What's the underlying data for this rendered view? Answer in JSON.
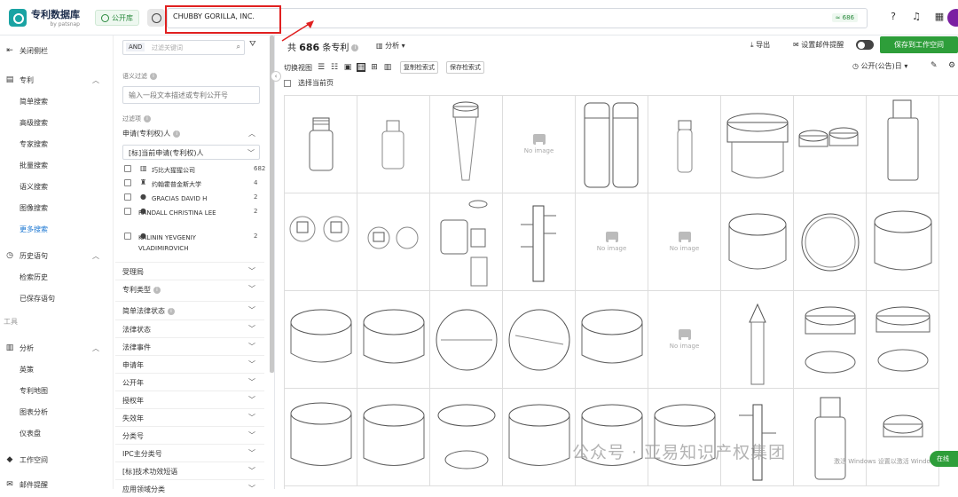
{
  "app": {
    "logo_title": "专利数据库",
    "logo_sub": "by patsnap",
    "db_badge": "公开库"
  },
  "search": {
    "query": "CHUBBY GORILLA, INC.",
    "count_badge": "≈ 686"
  },
  "sidenav": {
    "close": "关闭侧栏",
    "patent_section": "专利",
    "items": [
      "简单搜索",
      "高级搜索",
      "专家搜索",
      "批量搜索",
      "语义搜索",
      "图像搜索",
      "更多搜索"
    ],
    "history_section": "历史语句",
    "history_items": [
      "检索历史",
      "已保存语句"
    ],
    "tools_label": "工具",
    "analysis_section": "分析",
    "analysis_items": [
      "英策",
      "专利地图",
      "图表分析",
      "仪表盘"
    ],
    "workspace": "工作空间",
    "email_alert": "邮件提醒"
  },
  "filter": {
    "and_tag": "AND",
    "search_placeholder": "过滤关键词",
    "semantic_label": "语义过滤",
    "semantic_placeholder": "输入一段文本描述或专利公开号",
    "filter_label": "过滤项",
    "applicant_group": "申请(专利权)人",
    "applicant_select": "[标]当前申请(专利权)人",
    "applicants": [
      {
        "name": "巧比大猩猩公司",
        "count": "682",
        "icon": "company-icon"
      },
      {
        "name": "约翰霍普金斯大学",
        "count": "4",
        "icon": "school-icon"
      },
      {
        "name": "GRACIAS DAVID H",
        "count": "2",
        "icon": "person-icon"
      },
      {
        "name": "RANDALL CHRISTINA LEE",
        "count": "2",
        "icon": "person-icon"
      },
      {
        "name": "KALININ YEVGENIY VLADIMIROVICH",
        "count": "2",
        "icon": "person-icon"
      }
    ],
    "facets": [
      "受理局",
      "专利类型",
      "简单法律状态",
      "法律状态",
      "法律事件",
      "申请年",
      "公开年",
      "授权年",
      "失效年",
      "分类号",
      "IPC主分类号",
      "[标]技术功效短语",
      "应用领域分类"
    ]
  },
  "main": {
    "result_prefix": "共",
    "result_count": "686",
    "result_suffix": "条专利",
    "analysis": "分析",
    "export": "导出",
    "email_alert": "设置邮件提醒",
    "save_workspace": "保存到工作空间",
    "view_label": "切换视图",
    "copy_query": "复制检索式",
    "save_query": "保存检索式",
    "sort": "公开(公告)日",
    "select_page": "选择当前页",
    "no_image": "No image"
  },
  "overlay": {
    "watermark": "公众号 · 亚易知识产权集团",
    "activate": "激活 Windows 设置以激活 Windows。",
    "chat": "在线"
  }
}
